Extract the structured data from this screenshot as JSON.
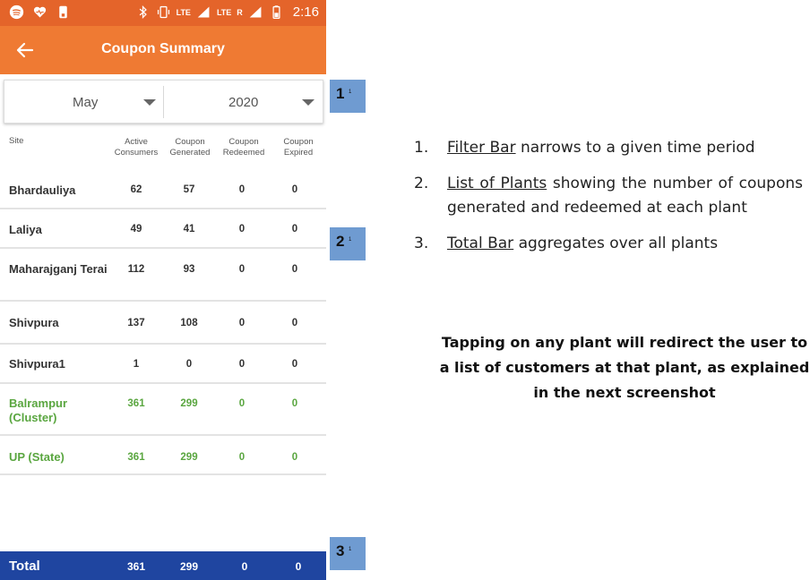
{
  "status_bar": {
    "time": "2:16",
    "lte_label": "LTE",
    "lte_label_2": "LTE",
    "roaming": "R",
    "icons": [
      "spotify-icon",
      "heart-icon",
      "phone-icon",
      "bluetooth-icon",
      "vibrate-icon",
      "volte-icon",
      "signal-icon",
      "signal-icon",
      "battery-icon"
    ]
  },
  "app_bar": {
    "title": "Coupon Summary",
    "back_icon": "arrow-back-icon"
  },
  "filter": {
    "month": "May",
    "year": "2020"
  },
  "table": {
    "columns": [
      {
        "line1": "Site",
        "line2": ""
      },
      {
        "line1": "Active",
        "line2": "Consumers"
      },
      {
        "line1": "Coupon",
        "line2": "Generated"
      },
      {
        "line1": "Coupon",
        "line2": "Redeemed"
      },
      {
        "line1": "Coupon",
        "line2": "Expired"
      }
    ],
    "rows": [
      {
        "site": "Bhardauliya",
        "active": "62",
        "generated": "57",
        "redeemed": "0",
        "expired": "0"
      },
      {
        "site": "Laliya",
        "active": "49",
        "generated": "41",
        "redeemed": "0",
        "expired": "0"
      },
      {
        "site": "Maharajganj Terai",
        "active": "112",
        "generated": "93",
        "redeemed": "0",
        "expired": "0"
      },
      {
        "site": "Shivpura",
        "active": "137",
        "generated": "108",
        "redeemed": "0",
        "expired": "0"
      },
      {
        "site": "Shivpura1",
        "active": "1",
        "generated": "0",
        "redeemed": "0",
        "expired": "0"
      },
      {
        "site": "Balrampur (Cluster)",
        "active": "361",
        "generated": "299",
        "redeemed": "0",
        "expired": "0"
      },
      {
        "site": "UP (State)",
        "active": "361",
        "generated": "299",
        "redeemed": "0",
        "expired": "0"
      }
    ]
  },
  "total": {
    "label": "Total",
    "active": "361",
    "generated": "299",
    "redeemed": "0",
    "expired": "0"
  },
  "markers": [
    {
      "num": "1",
      "sup": "1"
    },
    {
      "num": "2",
      "sup": "1"
    },
    {
      "num": "3",
      "sup": "1"
    }
  ],
  "notes": [
    {
      "num": "1.",
      "term": "Filter Bar",
      "rest": " narrows to a given time period"
    },
    {
      "num": "2.",
      "term": "List of Plants",
      "rest": " showing the number of coupons generated and redeemed at each plant"
    },
    {
      "num": "3.",
      "term": "Total Bar",
      "rest": " aggregates over all plants"
    }
  ],
  "tapping_note": "Tapping on any plant will redirect the user to a list of customers at that plant, as explained in the next screenshot",
  "colors": {
    "status_bar": "#e4642a",
    "app_bar": "#ef7a33",
    "total_bar": "#1f45a0",
    "marker": "#6f9bd1",
    "cluster_green": "#5aa640"
  }
}
